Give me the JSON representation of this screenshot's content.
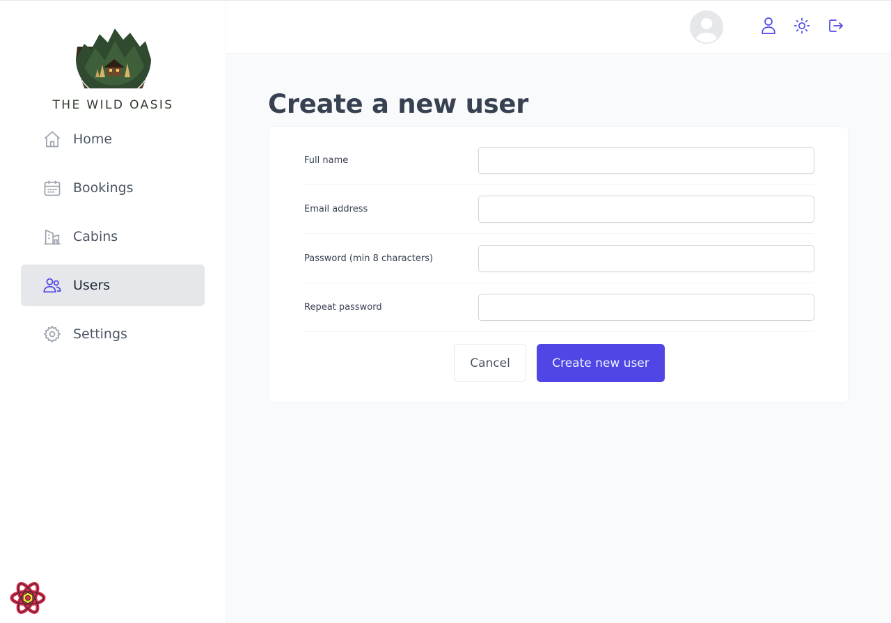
{
  "brand": {
    "name": "THE WILD OASIS"
  },
  "sidebar": {
    "items": [
      {
        "label": "Home",
        "icon": "home-icon",
        "active": false
      },
      {
        "label": "Bookings",
        "icon": "calendar-icon",
        "active": false
      },
      {
        "label": "Cabins",
        "icon": "building-icon",
        "active": false
      },
      {
        "label": "Users",
        "icon": "users-icon",
        "active": true
      },
      {
        "label": "Settings",
        "icon": "gear-icon",
        "active": false
      }
    ]
  },
  "header": {
    "avatar": "default-avatar",
    "icons": [
      "user-icon",
      "sun-icon",
      "logout-icon"
    ]
  },
  "page": {
    "title": "Create a new user"
  },
  "form": {
    "fields": [
      {
        "label": "Full name",
        "value": ""
      },
      {
        "label": "Email address",
        "value": ""
      },
      {
        "label": "Password (min 8 characters)",
        "value": ""
      },
      {
        "label": "Repeat password",
        "value": ""
      }
    ],
    "cancel_label": "Cancel",
    "submit_label": "Create new user"
  },
  "colors": {
    "accent": "#4f46e5",
    "active_nav_bg": "#e5e7eb",
    "page_bg": "#f9fafb"
  }
}
